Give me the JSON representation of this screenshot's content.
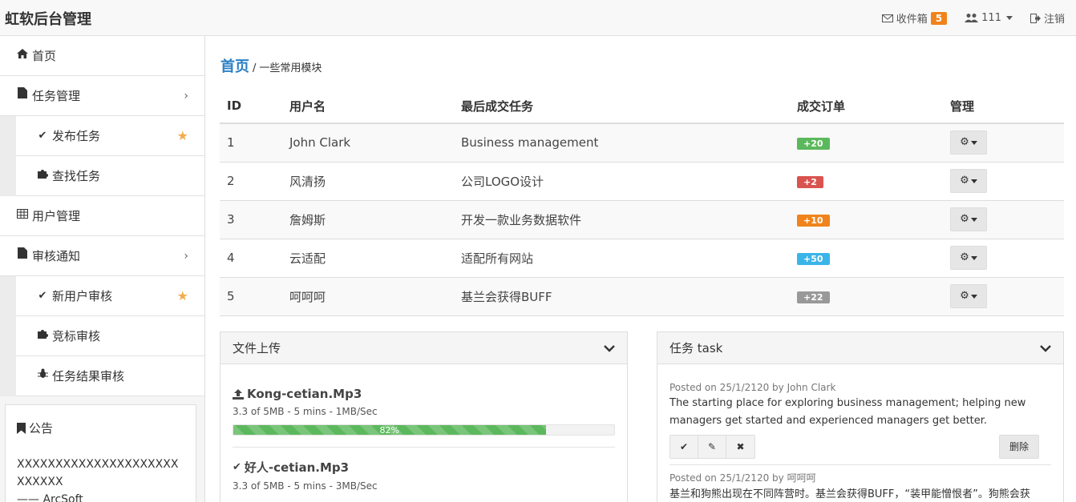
{
  "app": {
    "brand": "虹软后台管理"
  },
  "topbar": {
    "inbox_label": "收件箱",
    "inbox_count": "5",
    "user_label": "111",
    "logout_label": "注销"
  },
  "sidebar": {
    "home": "首页",
    "task_manage": "任务管理",
    "task_sub": [
      "发布任务",
      "查找任务"
    ],
    "user_manage": "用户管理",
    "review": "审核通知",
    "review_sub": [
      "新用户审核",
      "竞标审核",
      "任务结果审核"
    ]
  },
  "notice": {
    "title": "公告",
    "text": "XXXXXXXXXXXXXXXXXXXXXXXXXXX",
    "sign": "—— ArcSoft"
  },
  "breadcrumb": {
    "home": "首页",
    "sep": "/",
    "current": "一些常用模块"
  },
  "table": {
    "headers": [
      "ID",
      "用户名",
      "最后成交任务",
      "成交订单",
      "管理"
    ],
    "rows": [
      {
        "id": "1",
        "user": "John Clark",
        "task": "Business management",
        "orders": "+20",
        "color": "#5cb85c"
      },
      {
        "id": "2",
        "user": "风清扬",
        "task": "公司LOGO设计",
        "orders": "+2",
        "color": "#d9534f"
      },
      {
        "id": "3",
        "user": "詹姆斯",
        "task": "开发一款业务数据软件",
        "orders": "+10",
        "color": "#f0831b"
      },
      {
        "id": "4",
        "user": "云适配",
        "task": "适配所有网站",
        "orders": "+50",
        "color": "#3bb4e8"
      },
      {
        "id": "5",
        "user": "呵呵呵",
        "task": "基兰会获得BUFF",
        "orders": "+22",
        "color": "#999999"
      }
    ]
  },
  "upload": {
    "title": "文件上传",
    "items": [
      {
        "name": "Kong-cetian.Mp3",
        "meta": "3.3 of 5MB - 5 mins - 1MB/Sec",
        "progress": 0.82,
        "progress_label": "82%"
      },
      {
        "name": "好人-cetian.Mp3",
        "meta": "3.3 of 5MB - 5 mins - 3MB/Sec"
      }
    ]
  },
  "tasks": {
    "title": "任务 task",
    "posts": [
      {
        "meta_prefix": "Posted on 25/1/2120 by ",
        "author": "John Clark",
        "body": "The starting place for exploring business management; helping new managers get started and experienced managers get better.",
        "delete_label": "删除"
      },
      {
        "meta_prefix": "Posted on 25/1/2120 by ",
        "author": "呵呵呵",
        "body": "基兰和狗熊出现在不同阵营时。基兰会获得BUFF，“装甲能憎恨者”。狗熊会获"
      }
    ]
  }
}
